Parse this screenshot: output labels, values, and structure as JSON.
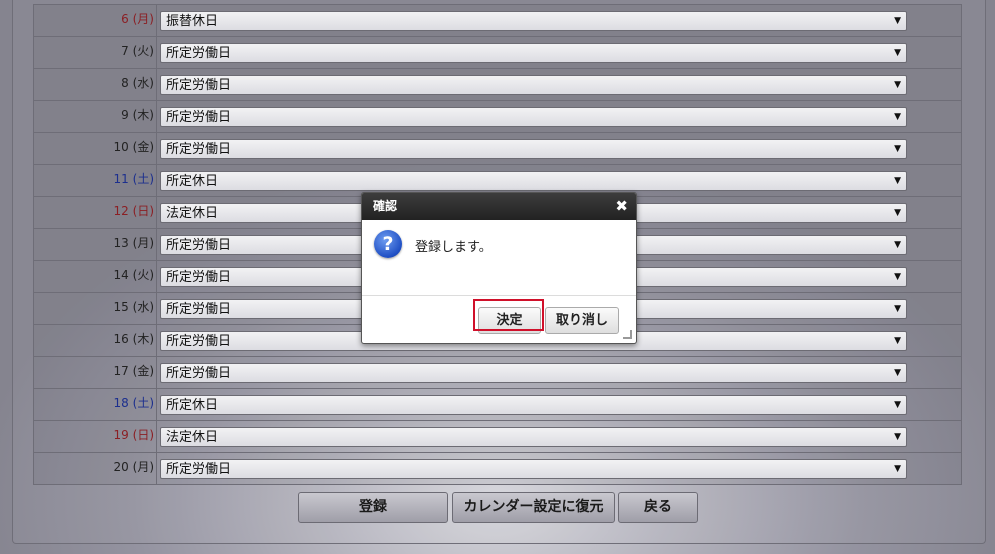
{
  "rows": [
    {
      "date": "6 (月)",
      "value": "振替休日",
      "type": "sun"
    },
    {
      "date": "7 (火)",
      "value": "所定労働日",
      "type": "weekday"
    },
    {
      "date": "8 (水)",
      "value": "所定労働日",
      "type": "weekday"
    },
    {
      "date": "9 (木)",
      "value": "所定労働日",
      "type": "weekday"
    },
    {
      "date": "10 (金)",
      "value": "所定労働日",
      "type": "weekday"
    },
    {
      "date": "11 (土)",
      "value": "所定休日",
      "type": "sat"
    },
    {
      "date": "12 (日)",
      "value": "法定休日",
      "type": "sun"
    },
    {
      "date": "13 (月)",
      "value": "所定労働日",
      "type": "weekday"
    },
    {
      "date": "14 (火)",
      "value": "所定労働日",
      "type": "weekday"
    },
    {
      "date": "15 (水)",
      "value": "所定労働日",
      "type": "weekday"
    },
    {
      "date": "16 (木)",
      "value": "所定労働日",
      "type": "weekday"
    },
    {
      "date": "17 (金)",
      "value": "所定労働日",
      "type": "weekday"
    },
    {
      "date": "18 (土)",
      "value": "所定休日",
      "type": "sat"
    },
    {
      "date": "19 (日)",
      "value": "法定休日",
      "type": "sun"
    },
    {
      "date": "20 (月)",
      "value": "所定労働日",
      "type": "weekday"
    }
  ],
  "buttons": {
    "register": "登録",
    "restore": "カレンダー設定に復元",
    "back": "戻る"
  },
  "dialog": {
    "title": "確認",
    "close": "✖",
    "icon": "question-icon",
    "icon_glyph": "?",
    "message": "登録します。",
    "ok": "決定",
    "cancel": "取り消し"
  },
  "colors": {
    "sunday": "#8b1f24",
    "saturday": "#1c2f8e",
    "highlight": "#d0102a"
  }
}
